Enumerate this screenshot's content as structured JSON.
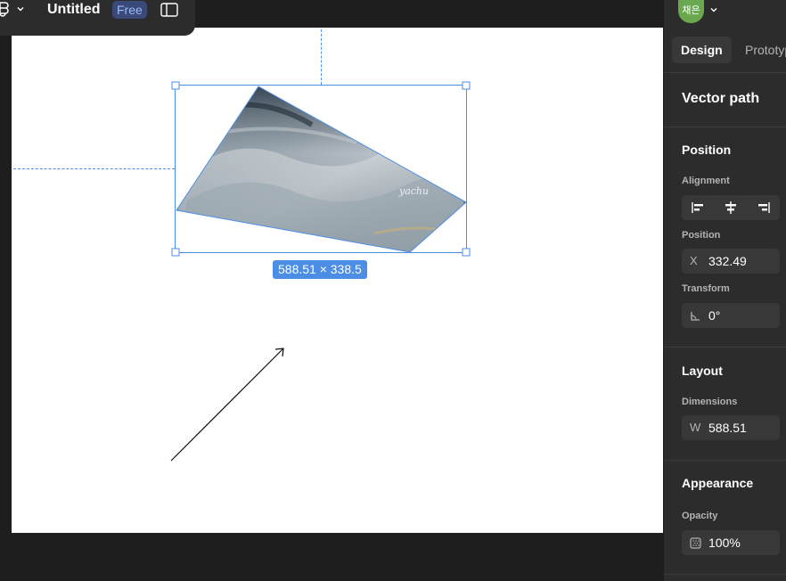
{
  "toolbar": {
    "doc_title": "Untitled",
    "plan_badge": "Free"
  },
  "canvas": {
    "dimension_label": "588.51 × 338.5"
  },
  "panel": {
    "avatar_text": "채은",
    "tabs": [
      {
        "label": "Design"
      },
      {
        "label": "Prototype"
      }
    ],
    "object_title": "Vector path",
    "position_section": {
      "title": "Position",
      "alignment_label": "Alignment",
      "position_label": "Position",
      "x_prefix": "X",
      "x_value": "332.49",
      "transform_label": "Transform",
      "rotation_value": "0°"
    },
    "layout_section": {
      "title": "Layout",
      "dimensions_label": "Dimensions",
      "w_prefix": "W",
      "w_value": "588.51"
    },
    "appearance_section": {
      "title": "Appearance",
      "opacity_label": "Opacity",
      "opacity_value": "100%"
    }
  },
  "colors": {
    "accent": "#4c8ee6",
    "panel_bg": "#2c2c2c",
    "canvas_bg": "#ffffff"
  }
}
